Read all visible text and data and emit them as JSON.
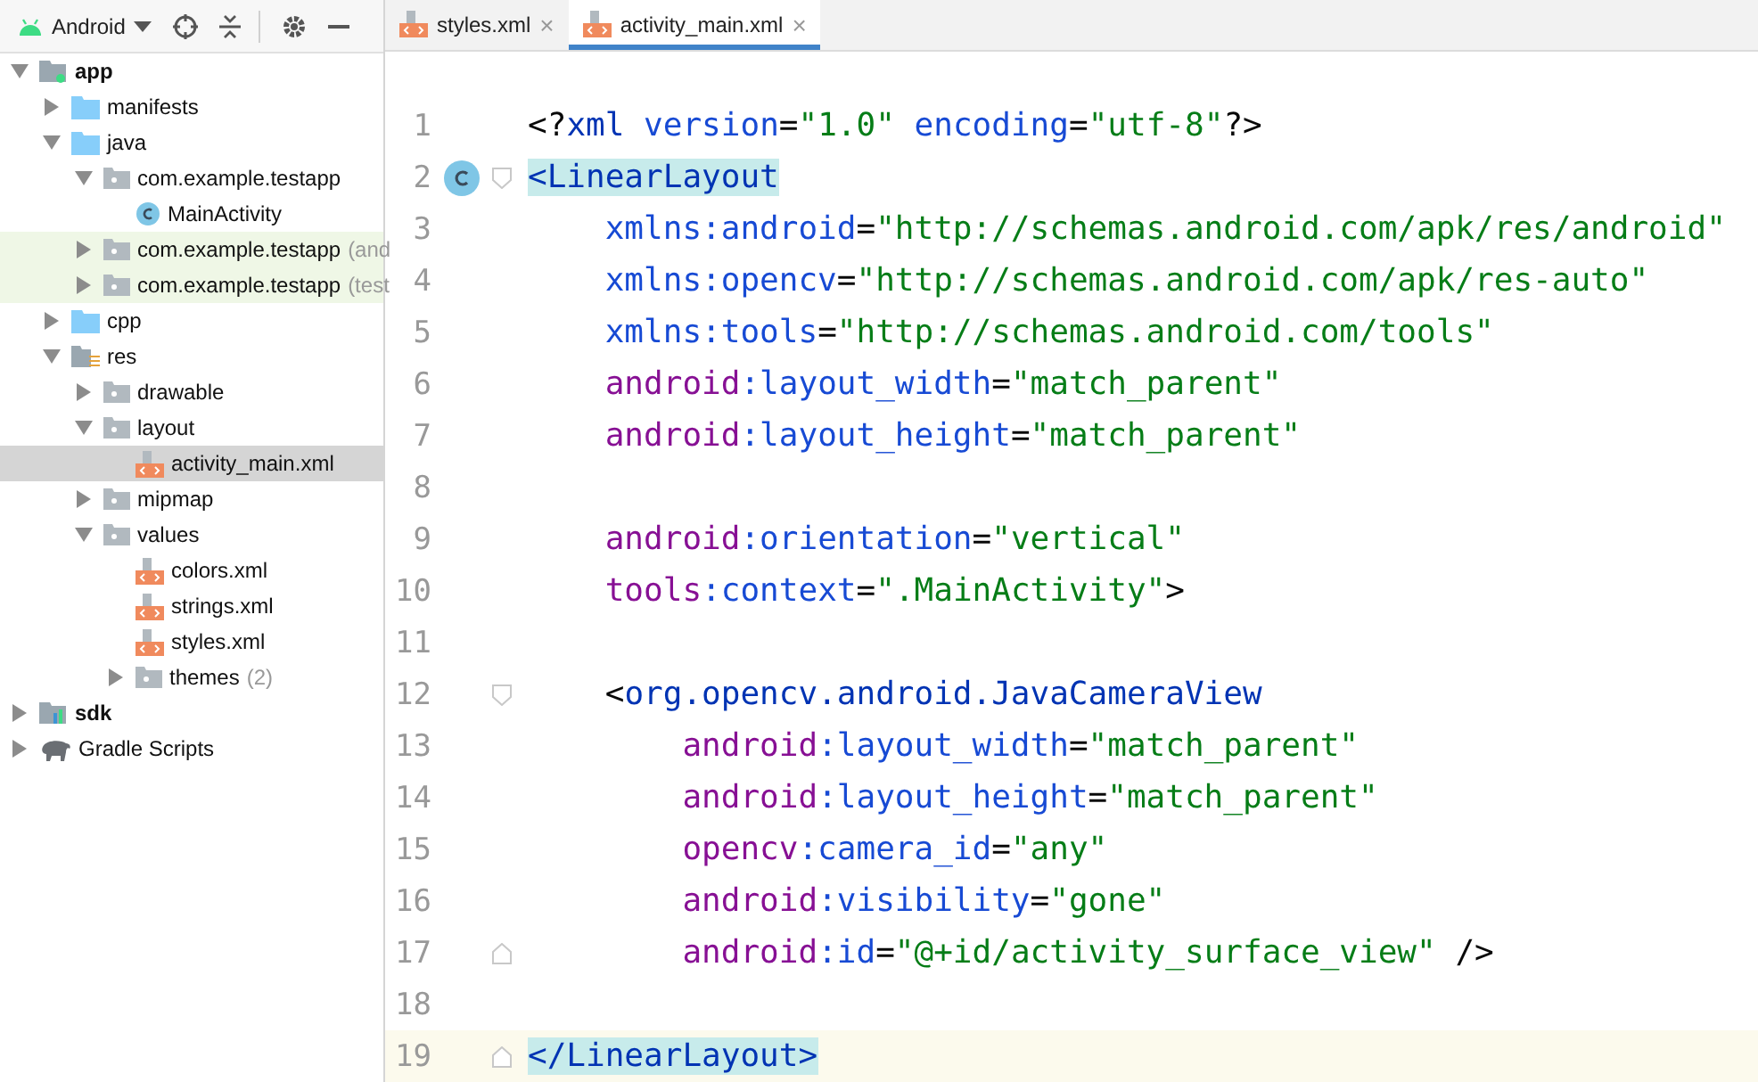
{
  "project_panel": {
    "view_selector": "Android",
    "tree": [
      {
        "label": "app",
        "kind": "module",
        "bold": true,
        "expanded": true,
        "selected": false,
        "children": [
          {
            "label": "manifests",
            "kind": "folder",
            "expanded": false,
            "selected": false
          },
          {
            "label": "java",
            "kind": "folder",
            "expanded": true,
            "selected": false,
            "children": [
              {
                "label": "com.example.testapp",
                "kind": "package",
                "expanded": true,
                "selected": false,
                "highlighted": false,
                "children": [
                  {
                    "label": "MainActivity",
                    "kind": "class",
                    "selected": false
                  }
                ]
              },
              {
                "label": "com.example.testapp",
                "note": "(and",
                "kind": "package",
                "expanded": false,
                "selected": false,
                "highlighted": true
              },
              {
                "label": "com.example.testapp",
                "note": "(test",
                "kind": "package",
                "expanded": false,
                "selected": false,
                "highlighted": true
              }
            ]
          },
          {
            "label": "cpp",
            "kind": "folder",
            "expanded": false,
            "selected": false
          },
          {
            "label": "res",
            "kind": "res",
            "expanded": true,
            "selected": false,
            "children": [
              {
                "label": "drawable",
                "kind": "package",
                "expanded": false,
                "selected": false
              },
              {
                "label": "layout",
                "kind": "package",
                "expanded": true,
                "selected": false,
                "children": [
                  {
                    "label": "activity_main.xml",
                    "kind": "xml",
                    "selected": true
                  }
                ]
              },
              {
                "label": "mipmap",
                "kind": "package",
                "expanded": false,
                "selected": false
              },
              {
                "label": "values",
                "kind": "package",
                "expanded": true,
                "selected": false,
                "children": [
                  {
                    "label": "colors.xml",
                    "kind": "xml",
                    "selected": false
                  },
                  {
                    "label": "strings.xml",
                    "kind": "xml",
                    "selected": false
                  },
                  {
                    "label": "styles.xml",
                    "kind": "xml",
                    "selected": false
                  },
                  {
                    "label": "themes",
                    "note": "(2)",
                    "kind": "package",
                    "expanded": false,
                    "selected": false
                  }
                ]
              }
            ]
          }
        ]
      },
      {
        "label": "sdk",
        "kind": "sdk",
        "bold": true,
        "expanded": false,
        "selected": false
      },
      {
        "label": "Gradle Scripts",
        "kind": "gradle",
        "bold": false,
        "expanded": false,
        "selected": false
      }
    ]
  },
  "editor": {
    "tabs": [
      {
        "label": "styles.xml",
        "close": "×",
        "selected": false
      },
      {
        "label": "activity_main.xml",
        "close": "×",
        "selected": true
      }
    ],
    "lines": [
      {
        "number": "1",
        "kind": "plain",
        "current": false,
        "segments": [
          {
            "kind": "punct",
            "text": "<?"
          },
          {
            "kind": "tag",
            "text": "xml "
          },
          {
            "kind": "attr",
            "text": "version"
          },
          {
            "kind": "punct",
            "text": "="
          },
          {
            "kind": "value",
            "text": "\"1.0\" "
          },
          {
            "kind": "attr",
            "text": "encoding"
          },
          {
            "kind": "punct",
            "text": "="
          },
          {
            "kind": "value",
            "text": "\"utf-8\""
          },
          {
            "kind": "punct",
            "text": "?>"
          }
        ]
      },
      {
        "number": "2",
        "kind": "class_fold_start",
        "current": false,
        "segments": [
          {
            "kind": "match",
            "text": "<LinearLayout"
          }
        ]
      },
      {
        "number": "3",
        "kind": "plain",
        "current": false,
        "segments": [
          {
            "kind": "attr",
            "text": "    xmlns:android"
          },
          {
            "kind": "punct",
            "text": "="
          },
          {
            "kind": "value",
            "text": "\"http://schemas.android.com/apk/res/android\""
          }
        ]
      },
      {
        "number": "4",
        "kind": "plain",
        "current": false,
        "segments": [
          {
            "kind": "attr",
            "text": "    xmlns:opencv"
          },
          {
            "kind": "punct",
            "text": "="
          },
          {
            "kind": "value",
            "text": "\"http://schemas.android.com/apk/res-auto\""
          }
        ]
      },
      {
        "number": "5",
        "kind": "plain",
        "current": false,
        "segments": [
          {
            "kind": "attr",
            "text": "    xmlns:tools"
          },
          {
            "kind": "punct",
            "text": "="
          },
          {
            "kind": "value",
            "text": "\"http://schemas.android.com/tools\""
          }
        ]
      },
      {
        "number": "6",
        "kind": "plain",
        "current": false,
        "segments": [
          {
            "kind": "ns",
            "text": "    android"
          },
          {
            "kind": "attr",
            "text": ":layout_width"
          },
          {
            "kind": "punct",
            "text": "="
          },
          {
            "kind": "value",
            "text": "\"match_parent\""
          }
        ]
      },
      {
        "number": "7",
        "kind": "plain",
        "current": false,
        "segments": [
          {
            "kind": "ns",
            "text": "    android"
          },
          {
            "kind": "attr",
            "text": ":layout_height"
          },
          {
            "kind": "punct",
            "text": "="
          },
          {
            "kind": "value",
            "text": "\"match_parent\""
          }
        ]
      },
      {
        "number": "8",
        "kind": "plain",
        "current": false
      },
      {
        "number": "9",
        "kind": "plain",
        "current": false,
        "segments": [
          {
            "kind": "ns",
            "text": "    android"
          },
          {
            "kind": "attr",
            "text": ":orientation"
          },
          {
            "kind": "punct",
            "text": "="
          },
          {
            "kind": "value",
            "text": "\"vertical\""
          }
        ]
      },
      {
        "number": "10",
        "kind": "plain",
        "current": false,
        "segments": [
          {
            "kind": "ns",
            "text": "    tools"
          },
          {
            "kind": "attr",
            "text": ":context"
          },
          {
            "kind": "punct",
            "text": "="
          },
          {
            "kind": "value",
            "text": "\".MainActivity\""
          },
          {
            "kind": "punct",
            "text": ">"
          }
        ]
      },
      {
        "number": "11",
        "kind": "plain",
        "current": false
      },
      {
        "number": "12",
        "kind": "fold_start",
        "current": false,
        "segments": [
          {
            "kind": "punct",
            "text": "    <"
          },
          {
            "kind": "tag",
            "text": "org.opencv.android.JavaCameraView"
          }
        ]
      },
      {
        "number": "13",
        "kind": "plain",
        "current": false,
        "segments": [
          {
            "kind": "ns",
            "text": "        android"
          },
          {
            "kind": "attr",
            "text": ":layout_width"
          },
          {
            "kind": "punct",
            "text": "="
          },
          {
            "kind": "value",
            "text": "\"match_parent\""
          }
        ]
      },
      {
        "number": "14",
        "kind": "plain",
        "current": false,
        "segments": [
          {
            "kind": "ns",
            "text": "        android"
          },
          {
            "kind": "attr",
            "text": ":layout_height"
          },
          {
            "kind": "punct",
            "text": "="
          },
          {
            "kind": "value",
            "text": "\"match_parent\""
          }
        ]
      },
      {
        "number": "15",
        "kind": "plain",
        "current": false,
        "segments": [
          {
            "kind": "ns",
            "text": "        opencv"
          },
          {
            "kind": "attr",
            "text": ":camera_id"
          },
          {
            "kind": "punct",
            "text": "="
          },
          {
            "kind": "value",
            "text": "\"any\""
          }
        ]
      },
      {
        "number": "16",
        "kind": "plain",
        "current": false,
        "segments": [
          {
            "kind": "ns",
            "text": "        android"
          },
          {
            "kind": "attr",
            "text": ":visibility"
          },
          {
            "kind": "punct",
            "text": "="
          },
          {
            "kind": "value",
            "text": "\"gone\""
          }
        ]
      },
      {
        "number": "17",
        "kind": "fold_end",
        "current": false,
        "segments": [
          {
            "kind": "ns",
            "text": "        android"
          },
          {
            "kind": "attr",
            "text": ":id"
          },
          {
            "kind": "punct",
            "text": "="
          },
          {
            "kind": "value",
            "text": "\"@+id/activity_surface_view\""
          },
          {
            "kind": "punct",
            "text": " />"
          }
        ]
      },
      {
        "number": "18",
        "kind": "plain",
        "current": false
      },
      {
        "number": "19",
        "kind": "fold_end",
        "current": true,
        "segments": [
          {
            "kind": "match",
            "text": "</LinearLayout>"
          }
        ]
      }
    ]
  }
}
